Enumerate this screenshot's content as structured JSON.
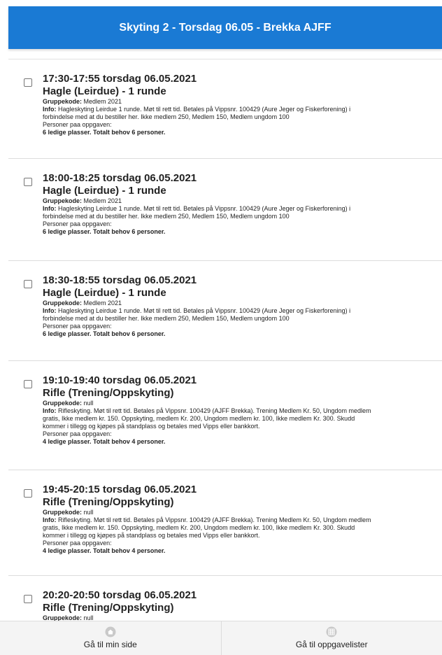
{
  "header": {
    "title": "Skyting 2 - Torsdag 06.05 - Brekka AJFF"
  },
  "tasks": [
    {
      "time": "17:30-17:55 torsdag 06.05.2021",
      "name": "Hagle (Leirdue) - 1 runde",
      "group_label": "Gruppekode:",
      "group_value": "Medlem 2021",
      "info_label": "Info:",
      "info_lines": [
        "Hagleskyting Leirdue 1 runde. Møt til rett tid. Betales på Vippsnr. 100429 (Aure Jeger og Fiskerforening) i",
        "forbindelse med at du bestiller her. Ikke medlem 250, Medlem 150, Medlem ungdom 100"
      ],
      "persons_label": "Personer paa oppgaven:",
      "capacity": "6 ledige plasser. Totalt behov 6 personer."
    },
    {
      "time": "18:00-18:25 torsdag 06.05.2021",
      "name": "Hagle (Leirdue) - 1 runde",
      "group_label": "Gruppekode:",
      "group_value": "Medlem 2021",
      "info_label": "Info:",
      "info_lines": [
        "Hagleskyting Leirdue 1 runde. Møt til rett tid. Betales på Vippsnr. 100429 (Aure Jeger og Fiskerforening) i",
        "forbindelse med at du bestiller her. Ikke medlem 250, Medlem 150, Medlem ungdom 100"
      ],
      "persons_label": "Personer paa oppgaven:",
      "capacity": "6 ledige plasser. Totalt behov 6 personer."
    },
    {
      "time": "18:30-18:55 torsdag 06.05.2021",
      "name": "Hagle (Leirdue) - 1 runde",
      "group_label": "Gruppekode:",
      "group_value": "Medlem 2021",
      "info_label": "Info:",
      "info_lines": [
        "Hagleskyting Leirdue 1 runde. Møt til rett tid. Betales på Vippsnr. 100429 (Aure Jeger og Fiskerforening) i",
        "forbindelse med at du bestiller her. Ikke medlem 250, Medlem 150, Medlem ungdom 100"
      ],
      "persons_label": "Personer paa oppgaven:",
      "capacity": "6 ledige plasser. Totalt behov 6 personer."
    },
    {
      "time": "19:10-19:40 torsdag 06.05.2021",
      "name": "Rifle (Trening/Oppskyting)",
      "group_label": "Gruppekode:",
      "group_value": "null",
      "info_label": "Info:",
      "info_lines": [
        "Rifleskyting. Møt til rett tid. Betales på Vippsnr. 100429 (AJFF Brekka). Trening Medlem Kr. 50, Ungdom medlem",
        "gratis, Ikke medlem kr. 150. Oppskyting, medlem Kr. 200, Ungdom medlem kr. 100, Ikke medlem Kr. 300. Skudd",
        "kommer i tillegg og kjøpes på standplass og betales med Vipps eller bankkort."
      ],
      "persons_label": "Personer paa oppgaven:",
      "capacity": "4 ledige plasser. Totalt behov 4 personer."
    },
    {
      "time": "19:45-20:15 torsdag 06.05.2021",
      "name": "Rifle (Trening/Oppskyting)",
      "group_label": "Gruppekode:",
      "group_value": "null",
      "info_label": "Info:",
      "info_lines": [
        "Rifleskyting. Møt til rett tid. Betales på Vippsnr. 100429 (AJFF Brekka). Trening Medlem Kr. 50, Ungdom medlem",
        "gratis, Ikke medlem kr. 150. Oppskyting, medlem Kr. 200, Ungdom medlem kr. 100, Ikke medlem Kr. 300. Skudd",
        "kommer i tillegg og kjøpes på standplass og betales med Vipps eller bankkort."
      ],
      "persons_label": "Personer paa oppgaven:",
      "capacity": "4 ledige plasser. Totalt behov 4 personer."
    },
    {
      "time": "20:20-20:50 torsdag 06.05.2021",
      "name": "Rifle (Trening/Oppskyting)",
      "group_label": "Gruppekode:",
      "group_value": "null",
      "info_label": "",
      "info_lines": [],
      "persons_label": "",
      "capacity": ""
    }
  ],
  "bottom_nav": {
    "home_label": "Gå til min side",
    "home_icon": "home-icon",
    "lists_label": "Gå til oppgavelister",
    "lists_icon": "grid-icon"
  }
}
